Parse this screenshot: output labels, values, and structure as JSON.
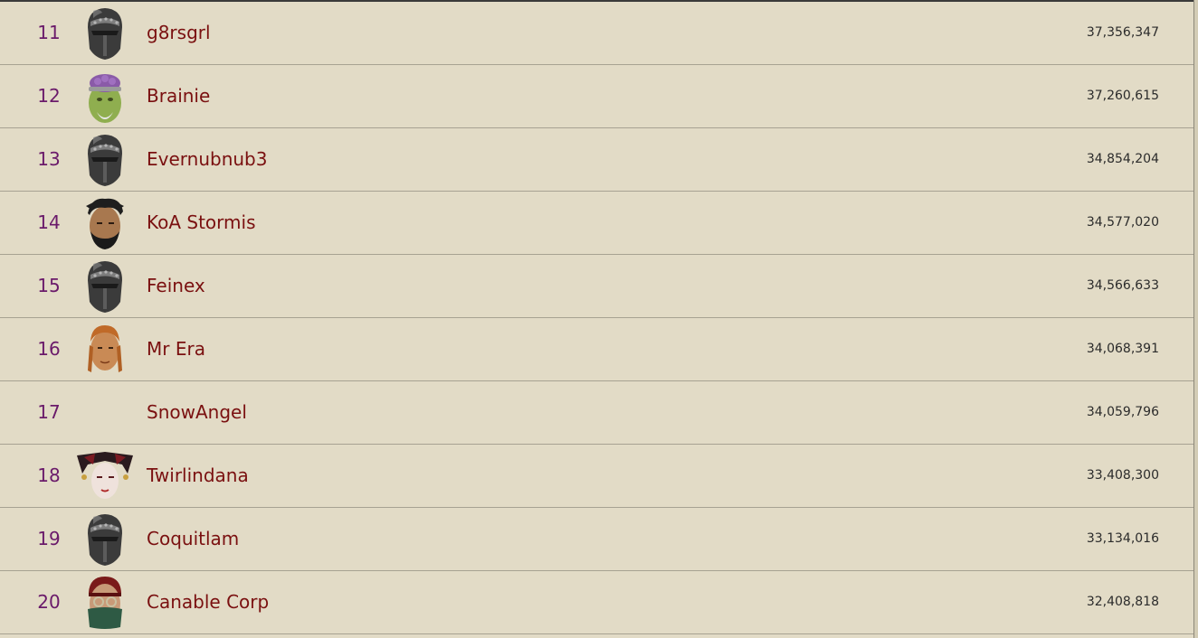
{
  "hiscores": {
    "rows": [
      {
        "rank": "11",
        "name": "g8rsgrl",
        "score": "37,356,347",
        "avatar": "helm-icon"
      },
      {
        "rank": "12",
        "name": "Brainie",
        "score": "37,260,615",
        "avatar": "brain-head-icon"
      },
      {
        "rank": "13",
        "name": "Evernubnub3",
        "score": "34,854,204",
        "avatar": "helm-icon"
      },
      {
        "rank": "14",
        "name": "KoA Stormis",
        "score": "34,577,020",
        "avatar": "bearded-head-icon"
      },
      {
        "rank": "15",
        "name": "Feinex",
        "score": "34,566,633",
        "avatar": "helm-icon"
      },
      {
        "rank": "16",
        "name": "Mr Era",
        "score": "34,068,391",
        "avatar": "braided-head-icon"
      },
      {
        "rank": "17",
        "name": "SnowAngel",
        "score": "34,059,796",
        "avatar": ""
      },
      {
        "rank": "18",
        "name": "Twirlindana",
        "score": "33,408,300",
        "avatar": "jester-head-icon"
      },
      {
        "rank": "19",
        "name": "Coquitlam",
        "score": "33,134,016",
        "avatar": "helm-icon"
      },
      {
        "rank": "20",
        "name": "Canable Corp",
        "score": "32,408,818",
        "avatar": "masked-head-icon"
      }
    ]
  },
  "colors": {
    "background": "#e2dbc6",
    "rank_text": "#6a1a6a",
    "name_text": "#7a1010",
    "score_text": "#2b2b2b",
    "row_divider": "#a7a292"
  }
}
